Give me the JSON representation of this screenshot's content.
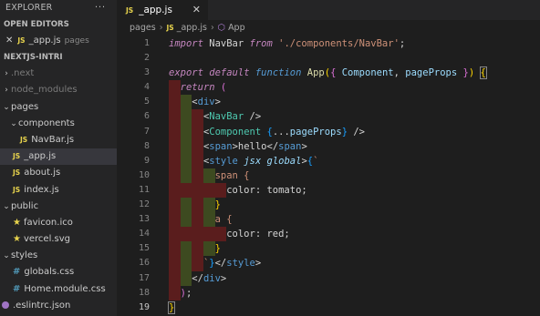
{
  "explorer": {
    "title": "EXPLORER",
    "more_label": "···",
    "open_editors_title": "OPEN EDITORS",
    "open_editor": {
      "close": "✕",
      "badge": "JS",
      "name": "_app.js",
      "folder": "pages"
    },
    "project_title": "NEXTJS-INTRI",
    "tree": [
      {
        "type": "folder",
        "name": ".next",
        "dim": true
      },
      {
        "type": "folder",
        "name": "node_modules",
        "dim": true
      },
      {
        "type": "folder",
        "name": "pages",
        "open": true
      },
      {
        "type": "folder",
        "name": "components",
        "open": true
      },
      {
        "type": "js",
        "name": "NavBar.js"
      },
      {
        "type": "js",
        "name": "_app.js",
        "active": true
      },
      {
        "type": "js",
        "name": "about.js"
      },
      {
        "type": "js",
        "name": "index.js"
      },
      {
        "type": "folder",
        "name": "public",
        "open": true
      },
      {
        "type": "star",
        "name": "favicon.ico"
      },
      {
        "type": "svg",
        "name": "vercel.svg"
      },
      {
        "type": "folder",
        "name": "styles",
        "open": true
      },
      {
        "type": "css",
        "name": "globals.css"
      },
      {
        "type": "css",
        "name": "Home.module.css"
      },
      {
        "type": "eslint",
        "name": ".eslintrc.json"
      }
    ],
    "icons": {
      "folder_closed": "›",
      "folder_open": "⌄",
      "js": "JS",
      "css": "#",
      "star": "★"
    }
  },
  "tab": {
    "badge": "JS",
    "name": "_app.js",
    "close": "✕"
  },
  "breadcrumb": {
    "folder": "pages",
    "sep": "›",
    "badge": "JS",
    "file": "_app.js",
    "symbol_icon": "⬡",
    "symbol": "App"
  },
  "code": {
    "line_numbers": [
      "1",
      "2",
      "3",
      "4",
      "5",
      "6",
      "7",
      "8",
      "9",
      "10",
      "11",
      "12",
      "13",
      "14",
      "15",
      "16",
      "17",
      "18",
      "19"
    ],
    "lines": [
      [
        {
          "c": "k it",
          "t": "import"
        },
        {
          "c": "p",
          "t": " NavBar "
        },
        {
          "c": "k it",
          "t": "from"
        },
        {
          "c": "p",
          "t": " "
        },
        {
          "c": "s",
          "t": "'./components/NavBar'"
        },
        {
          "c": "p",
          "t": ";"
        }
      ],
      [],
      [
        {
          "c": "k it",
          "t": "export"
        },
        {
          "c": "p",
          "t": " "
        },
        {
          "c": "k it",
          "t": "default"
        },
        {
          "c": "p",
          "t": " "
        },
        {
          "c": "kb it",
          "t": "function"
        },
        {
          "c": "p",
          "t": " "
        },
        {
          "c": "f",
          "t": "App"
        },
        {
          "c": "br1",
          "t": "("
        },
        {
          "c": "br2",
          "t": "{"
        },
        {
          "c": "p",
          "t": " "
        },
        {
          "c": "v",
          "t": "Component"
        },
        {
          "c": "p",
          "t": ", "
        },
        {
          "c": "v",
          "t": "pageProps"
        },
        {
          "c": "p",
          "t": " "
        },
        {
          "c": "br2",
          "t": "}"
        },
        {
          "c": "br1",
          "t": ")"
        },
        {
          "c": "p",
          "t": " "
        },
        {
          "c": "br1 cursor-box",
          "t": "{"
        }
      ],
      [
        {
          "c": "p",
          "t": "  "
        },
        {
          "c": "k it",
          "t": "return"
        },
        {
          "c": "p",
          "t": " "
        },
        {
          "c": "br2",
          "t": "("
        }
      ],
      [
        {
          "c": "p",
          "t": "    "
        },
        {
          "c": "p",
          "t": "<"
        },
        {
          "c": "tg",
          "t": "div"
        },
        {
          "c": "p",
          "t": ">"
        }
      ],
      [
        {
          "c": "p",
          "t": "      "
        },
        {
          "c": "p",
          "t": "<"
        },
        {
          "c": "t",
          "t": "NavBar"
        },
        {
          "c": "p",
          "t": " />"
        }
      ],
      [
        {
          "c": "p",
          "t": "      "
        },
        {
          "c": "p",
          "t": "<"
        },
        {
          "c": "t",
          "t": "Component"
        },
        {
          "c": "p",
          "t": " "
        },
        {
          "c": "br3",
          "t": "{"
        },
        {
          "c": "p",
          "t": "..."
        },
        {
          "c": "v",
          "t": "pageProps"
        },
        {
          "c": "br3",
          "t": "}"
        },
        {
          "c": "p",
          "t": " />"
        }
      ],
      [
        {
          "c": "p",
          "t": "      "
        },
        {
          "c": "p",
          "t": "<"
        },
        {
          "c": "tg",
          "t": "span"
        },
        {
          "c": "p",
          "t": ">hello</"
        },
        {
          "c": "tg",
          "t": "span"
        },
        {
          "c": "p",
          "t": ">"
        }
      ],
      [
        {
          "c": "p",
          "t": "      "
        },
        {
          "c": "p",
          "t": "<"
        },
        {
          "c": "tg",
          "t": "style"
        },
        {
          "c": "p",
          "t": " "
        },
        {
          "c": "v it",
          "t": "jsx"
        },
        {
          "c": "p",
          "t": " "
        },
        {
          "c": "v it",
          "t": "global"
        },
        {
          "c": "p",
          "t": ">"
        },
        {
          "c": "br3",
          "t": "{"
        },
        {
          "c": "s",
          "t": "`"
        }
      ],
      [
        {
          "c": "p",
          "t": "        "
        },
        {
          "c": "s",
          "t": "span {"
        }
      ],
      [
        {
          "c": "p",
          "t": "          "
        },
        {
          "c": "p",
          "t": "color: tomato;"
        }
      ],
      [
        {
          "c": "p",
          "t": "        "
        },
        {
          "c": "br1",
          "t": "}"
        }
      ],
      [
        {
          "c": "p",
          "t": "        "
        },
        {
          "c": "s",
          "t": "a {"
        }
      ],
      [
        {
          "c": "p",
          "t": "          "
        },
        {
          "c": "p",
          "t": "color: red;"
        }
      ],
      [
        {
          "c": "p",
          "t": "        "
        },
        {
          "c": "br1",
          "t": "}"
        }
      ],
      [
        {
          "c": "p",
          "t": "      "
        },
        {
          "c": "s",
          "t": "`"
        },
        {
          "c": "br3",
          "t": "}"
        },
        {
          "c": "p",
          "t": "</"
        },
        {
          "c": "tg",
          "t": "style"
        },
        {
          "c": "p",
          "t": ">"
        }
      ],
      [
        {
          "c": "p",
          "t": "    "
        },
        {
          "c": "p",
          "t": "</"
        },
        {
          "c": "tg",
          "t": "div"
        },
        {
          "c": "p",
          "t": ">"
        }
      ],
      [
        {
          "c": "p",
          "t": "  "
        },
        {
          "c": "br2",
          "t": ")"
        },
        {
          "c": "p",
          "t": ";"
        }
      ],
      [
        {
          "c": "br1 cursor-box",
          "t": "}"
        }
      ]
    ]
  },
  "colors": {
    "editor_bg": "#1e1e1e",
    "sidebar_bg": "#252526",
    "diff_removed": "#5a1d1d",
    "diff_added": "#3d4a20"
  }
}
